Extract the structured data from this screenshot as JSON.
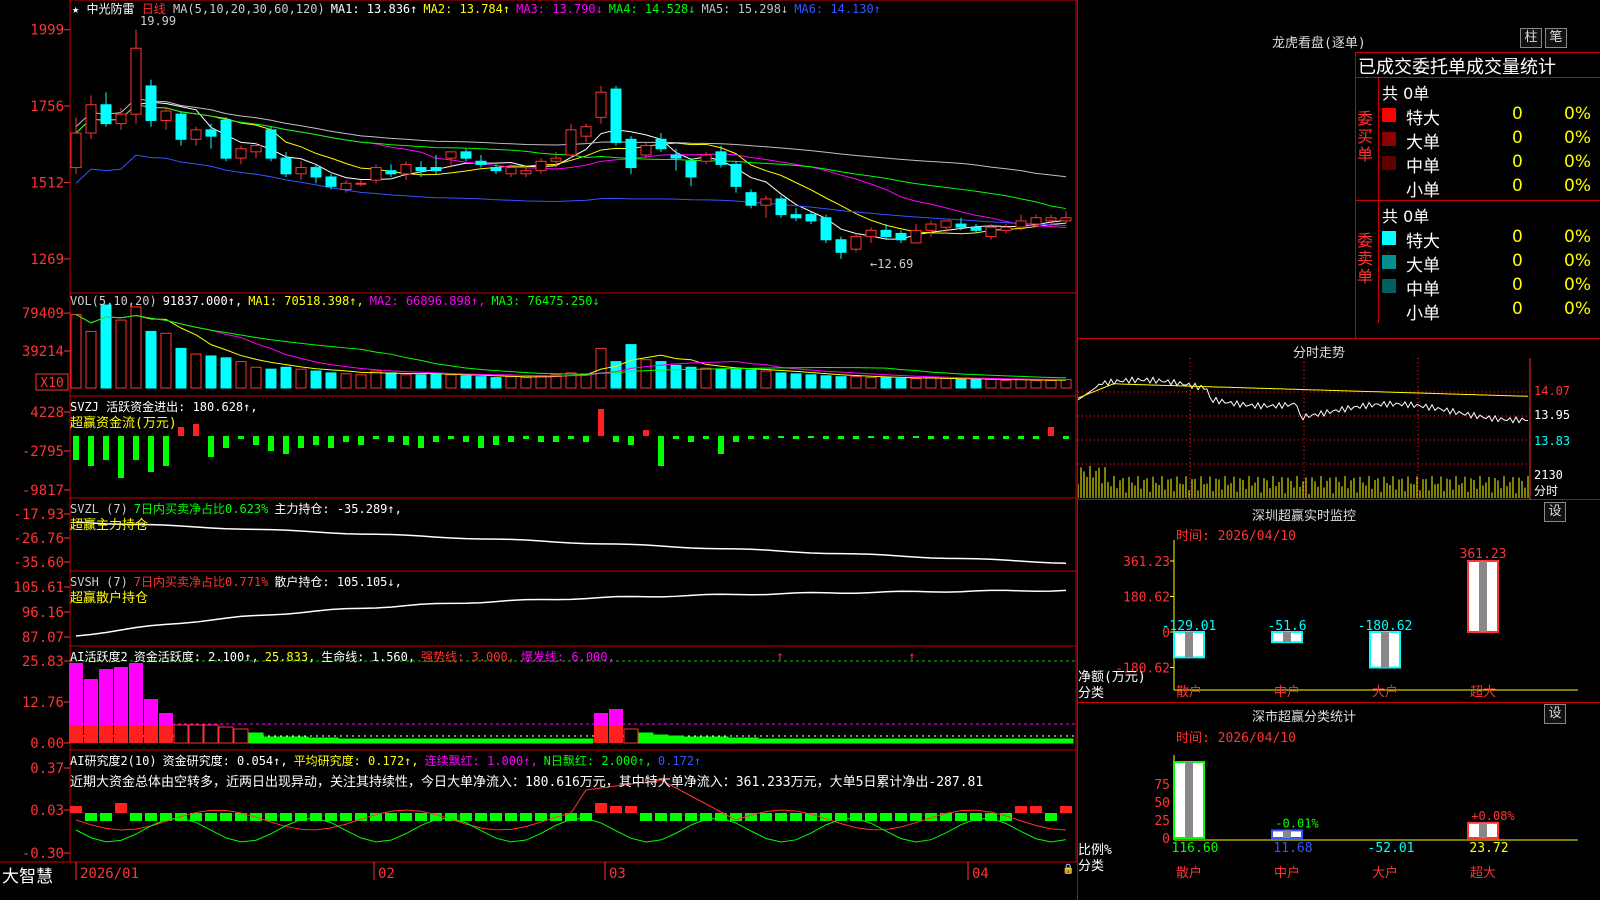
{
  "app": {
    "brand": "大智慧",
    "stock_name": "中光防雷",
    "period": "日线"
  },
  "kline": {
    "ma_header": [
      {
        "text": "MA(5,10,20,30,60,120)",
        "color": "#cccccc"
      },
      {
        "text": "MA1: 13.836↑",
        "color": "#ffffff"
      },
      {
        "text": "MA2: 13.784↑",
        "color": "#ffff00"
      },
      {
        "text": "MA3: 13.790↓",
        "color": "#ff00ff"
      },
      {
        "text": "MA4: 14.528↓",
        "color": "#00ff00"
      },
      {
        "text": "MA5: 15.298↓",
        "color": "#c0c0c0"
      },
      {
        "text": "MA6: 14.130↑",
        "color": "#3355ff"
      }
    ],
    "y_ticks": [
      "1999",
      "1756",
      "1512",
      "1269"
    ],
    "high_label": "19.99",
    "low_label": "12.69",
    "candles": [
      [
        15.6,
        17.2,
        15.4,
        16.7
      ],
      [
        16.7,
        17.9,
        16.5,
        17.6
      ],
      [
        17.6,
        18.0,
        16.9,
        17.0
      ],
      [
        17.0,
        17.5,
        16.8,
        17.3
      ],
      [
        17.3,
        19.99,
        17.0,
        19.4
      ],
      [
        18.2,
        18.4,
        16.9,
        17.1
      ],
      [
        17.1,
        17.5,
        16.8,
        17.4
      ],
      [
        17.3,
        17.4,
        16.3,
        16.5
      ],
      [
        16.5,
        16.9,
        16.3,
        16.8
      ],
      [
        16.8,
        17.0,
        16.2,
        16.6
      ],
      [
        17.1,
        17.2,
        15.8,
        15.9
      ],
      [
        15.9,
        16.3,
        15.7,
        16.2
      ],
      [
        16.1,
        16.4,
        15.9,
        16.3
      ],
      [
        16.8,
        16.9,
        15.8,
        15.9
      ],
      [
        15.9,
        16.1,
        15.3,
        15.4
      ],
      [
        15.4,
        15.8,
        15.2,
        15.6
      ],
      [
        15.6,
        15.7,
        15.1,
        15.3
      ],
      [
        15.3,
        15.4,
        14.9,
        15.0
      ],
      [
        14.9,
        15.2,
        14.8,
        15.1
      ],
      [
        15.1,
        15.2,
        15.0,
        15.1
      ],
      [
        15.2,
        15.7,
        15.1,
        15.6
      ],
      [
        15.5,
        15.7,
        15.3,
        15.4
      ],
      [
        15.4,
        15.8,
        15.2,
        15.7
      ],
      [
        15.6,
        15.8,
        15.3,
        15.5
      ],
      [
        15.6,
        16.0,
        15.4,
        15.5
      ],
      [
        15.9,
        16.1,
        15.6,
        16.1
      ],
      [
        16.1,
        16.2,
        15.8,
        15.9
      ],
      [
        15.8,
        16.0,
        15.6,
        15.7
      ],
      [
        15.6,
        15.7,
        15.4,
        15.5
      ],
      [
        15.4,
        15.7,
        15.3,
        15.6
      ],
      [
        15.4,
        15.6,
        15.3,
        15.5
      ],
      [
        15.5,
        15.9,
        15.4,
        15.8
      ],
      [
        15.8,
        16.1,
        15.6,
        15.9
      ],
      [
        16.0,
        17.0,
        15.9,
        16.8
      ],
      [
        16.6,
        17.0,
        16.4,
        16.9
      ],
      [
        17.2,
        18.2,
        17.0,
        18.0
      ],
      [
        18.1,
        18.2,
        16.3,
        16.4
      ],
      [
        16.5,
        16.6,
        15.4,
        15.6
      ],
      [
        16.0,
        16.4,
        15.9,
        16.3
      ],
      [
        16.5,
        16.7,
        16.1,
        16.2
      ],
      [
        16.0,
        16.2,
        15.5,
        15.9
      ],
      [
        15.8,
        15.9,
        15.0,
        15.3
      ],
      [
        15.8,
        16.1,
        15.7,
        16.0
      ],
      [
        16.1,
        16.3,
        15.6,
        15.7
      ],
      [
        15.7,
        15.8,
        14.8,
        15.0
      ],
      [
        14.8,
        14.9,
        14.3,
        14.4
      ],
      [
        14.4,
        14.7,
        14.0,
        14.6
      ],
      [
        14.6,
        14.7,
        14.0,
        14.1
      ],
      [
        14.1,
        14.3,
        13.9,
        14.0
      ],
      [
        14.1,
        14.2,
        13.8,
        13.9
      ],
      [
        14.0,
        14.1,
        13.2,
        13.3
      ],
      [
        13.3,
        13.4,
        12.69,
        12.9
      ],
      [
        13.0,
        13.5,
        12.9,
        13.4
      ],
      [
        13.4,
        13.7,
        13.2,
        13.6
      ],
      [
        13.6,
        13.8,
        13.3,
        13.4
      ],
      [
        13.5,
        13.6,
        13.2,
        13.3
      ],
      [
        13.2,
        13.8,
        13.2,
        13.6
      ],
      [
        13.6,
        13.9,
        13.4,
        13.8
      ],
      [
        13.7,
        13.9,
        13.5,
        13.9
      ],
      [
        13.8,
        14.0,
        13.6,
        13.7
      ],
      [
        13.7,
        13.8,
        13.5,
        13.6
      ],
      [
        13.4,
        13.8,
        13.3,
        13.7
      ],
      [
        13.6,
        13.8,
        13.5,
        13.7
      ],
      [
        13.7,
        14.1,
        13.6,
        13.9
      ],
      [
        13.8,
        14.1,
        13.7,
        14.0
      ],
      [
        13.9,
        14.1,
        13.7,
        14.0
      ],
      [
        13.9,
        14.2,
        13.8,
        14.0
      ]
    ]
  },
  "volume": {
    "header": [
      {
        "text": "VOL(5,10,20)",
        "color": "#cccccc"
      },
      {
        "text": "91837.000↑,",
        "color": "#ffffff"
      },
      {
        "text": "MA1: 70518.398↑,",
        "color": "#ffff00"
      },
      {
        "text": "MA2: 66896.898↑,",
        "color": "#ff00ff"
      },
      {
        "text": "MA3: 76475.250↓",
        "color": "#00ff00"
      }
    ],
    "y_ticks": [
      "79409",
      "39214"
    ],
    "unit": "X10",
    "values": [
      78,
      60,
      88,
      72,
      86,
      60,
      58,
      42,
      36,
      34,
      32,
      28,
      22,
      20,
      22,
      20,
      18,
      16,
      15,
      14,
      18,
      16,
      14,
      14,
      15,
      14,
      13,
      12,
      11,
      12,
      11,
      13,
      14,
      16,
      15,
      42,
      28,
      46,
      30,
      28,
      24,
      22,
      21,
      20,
      20,
      19,
      18,
      16,
      15,
      14,
      13,
      12,
      12,
      11,
      11,
      10,
      10,
      11,
      10,
      9,
      9,
      9,
      8,
      9,
      8,
      8,
      9
    ]
  },
  "svzj": {
    "header": [
      {
        "text": "SVZJ  活跃资金进出: 180.628↑,",
        "color": "#ffffff"
      }
    ],
    "subtitle": "超赢资金流(万元)",
    "y_ticks": [
      "4228",
      "-2795",
      "-9817"
    ]
  },
  "svzl": {
    "header": [
      {
        "text": "SVZL (7)",
        "color": "#cccccc"
      },
      {
        "text": "7日内买卖净占比0.623%",
        "color": "#00ff00"
      },
      {
        "text": "主力持仓: -35.289↑,",
        "color": "#ffffff"
      }
    ],
    "subtitle": "超赢主力持仓",
    "y_ticks": [
      "-17.93",
      "-26.76",
      "-35.60"
    ]
  },
  "svsh": {
    "header": [
      {
        "text": "SVSH (7)",
        "color": "#cccccc"
      },
      {
        "text": "7日内买卖净占比0.771%",
        "color": "#ff3333"
      },
      {
        "text": "散户持仓: 105.105↓,",
        "color": "#ffffff"
      }
    ],
    "subtitle": "超赢散户持仓",
    "y_ticks": [
      "105.61",
      "96.16",
      "87.07"
    ]
  },
  "ai_active": {
    "header": [
      {
        "text": "AI活跃度2",
        "color": "#ffffff"
      },
      {
        "text": "资金活跃度: 2.100↑,",
        "color": "#ffffff"
      },
      {
        "text": "25.833,",
        "color": "#ffff00"
      },
      {
        "text": "生命线: 1.560,",
        "color": "#ffffff"
      },
      {
        "text": "强势线: 3.000,",
        "color": "#ff3333"
      },
      {
        "text": "爆发线: 6.000,",
        "color": "#ff00ff"
      }
    ],
    "y_ticks": [
      "25.83",
      "12.76",
      "0.00"
    ]
  },
  "ai_research": {
    "header": [
      {
        "text": "AI研究度2(10)",
        "color": "#ffffff"
      },
      {
        "text": "资金研究度: 0.054↑,",
        "color": "#ffffff"
      },
      {
        "text": "平均研究度: 0.172↑,",
        "color": "#ffff00"
      },
      {
        "text": "连续飘红: 1.000↑,",
        "color": "#ff00ff"
      },
      {
        "text": "N日飘红: 2.000↑,",
        "color": "#00ff00"
      },
      {
        "text": "0.172↑",
        "color": "#3355ff"
      }
    ],
    "comment": "近期大资金总体由空转多，近两日出现异动，关注其持续性，今日大单净流入：180.616万元，其中特大单净流入：361.233万元，大单5日累计净出-287.81",
    "y_ticks": [
      "0.37",
      "0.03",
      "-0.30"
    ]
  },
  "x_axis": [
    "2026/01",
    "02",
    "03",
    "04"
  ],
  "right": {
    "lhb_title": "龙虎看盘(逐单)",
    "btn_zhu": "柱",
    "btn_bi": "笔",
    "lhb_subtitle": "已成交委托单成交量统计",
    "buy_label": "委买单",
    "sell_label": "委卖单",
    "buy_total": "共 0单",
    "sell_total": "共 0单",
    "buy_rows": [
      {
        "label": "特大",
        "color": "#ff0000",
        "count": "0",
        "pct": "0%"
      },
      {
        "label": "大单",
        "color": "#8b0000",
        "count": "0",
        "pct": "0%"
      },
      {
        "label": "中单",
        "color": "#600000",
        "count": "0",
        "pct": "0%"
      },
      {
        "label": "小单",
        "color": "#000000",
        "count": "0",
        "pct": "0%"
      }
    ],
    "sell_rows": [
      {
        "label": "特大",
        "color": "#00ffff",
        "count": "0",
        "pct": "0%"
      },
      {
        "label": "大单",
        "color": "#009090",
        "count": "0",
        "pct": "0%"
      },
      {
        "label": "中单",
        "color": "#006060",
        "count": "0",
        "pct": "0%"
      },
      {
        "label": "小单",
        "color": "#000000",
        "count": "0",
        "pct": "0%"
      }
    ],
    "intraday_title": "分时走势",
    "intraday_ticks": [
      "14.07",
      "13.95",
      "13.83"
    ],
    "intraday_vol": "2130",
    "intraday_unit": "分时",
    "monitor_title": "深圳超赢实时监控",
    "btn_settings": "设",
    "monitor_time": "时间: 2026/04/10",
    "monitor_ticks": [
      "361.23",
      "180.62",
      "0",
      "-180.62"
    ],
    "monitor_axis_label": "净额(万元)",
    "monitor_cat_label": "分类",
    "monitor_bars": [
      {
        "cat": "散户",
        "value": -129.01,
        "label": "-129.01"
      },
      {
        "cat": "中户",
        "value": -51.6,
        "label": "-51.6"
      },
      {
        "cat": "大户",
        "value": -180.62,
        "label": "-180.62"
      },
      {
        "cat": "超大",
        "value": 361.23,
        "label": "361.23"
      }
    ],
    "stats_title": "深市超赢分类统计",
    "stats_time": "时间: 2026/04/10",
    "stats_ticks": [
      "75",
      "50",
      "25",
      "0"
    ],
    "stats_axis_label": "比例%",
    "stats_cat_label": "分类",
    "stats_bars": [
      {
        "cat": "散户",
        "pct": 100,
        "value": "116.60",
        "top": ""
      },
      {
        "cat": "中户",
        "pct": 10,
        "value": "11.68",
        "top": "-0.01%"
      },
      {
        "cat": "大户",
        "pct": 0,
        "value": "-52.01",
        "top": ""
      },
      {
        "cat": "超大",
        "pct": 20,
        "value": "23.72",
        "top": "+0.08%"
      }
    ]
  }
}
